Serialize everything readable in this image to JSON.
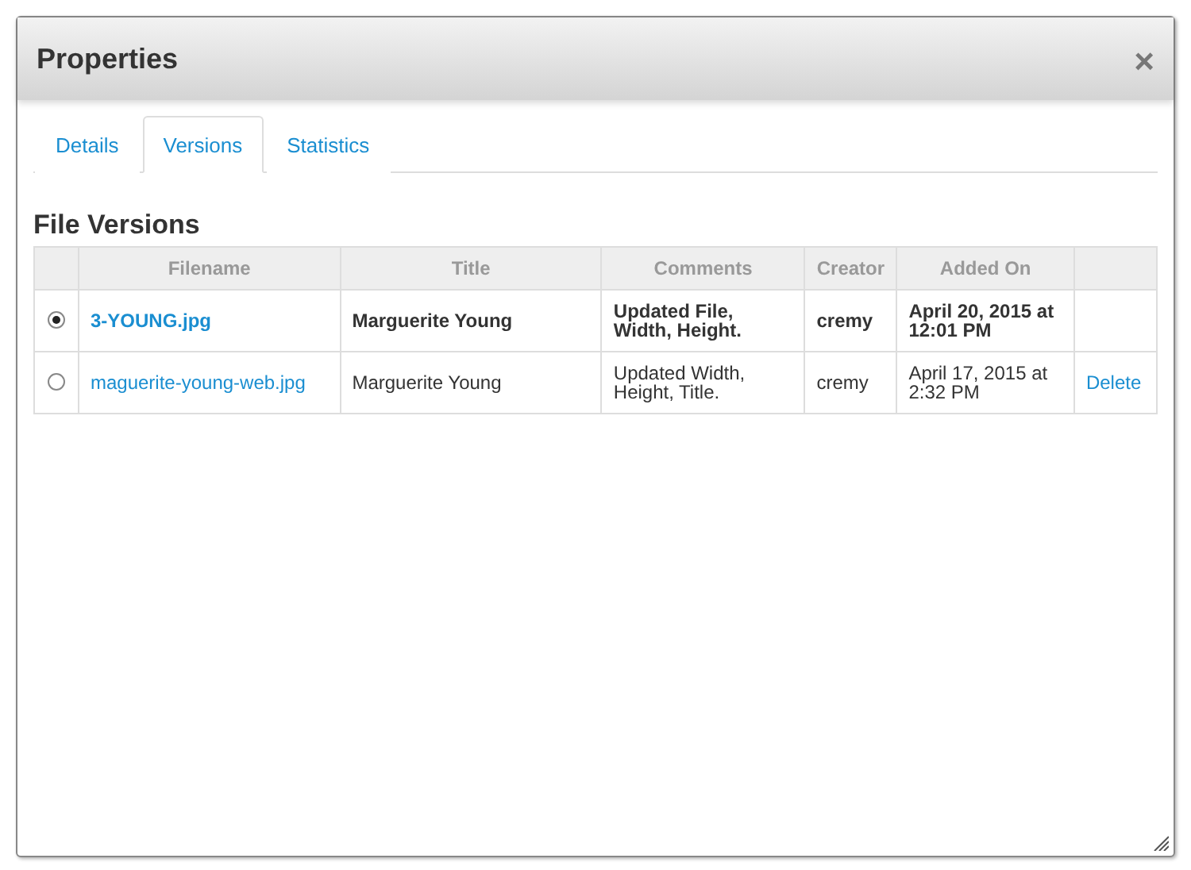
{
  "dialog": {
    "title": "Properties",
    "close": "×"
  },
  "tabs": [
    {
      "label": "Details",
      "selected": false
    },
    {
      "label": "Versions",
      "selected": true
    },
    {
      "label": "Statistics",
      "selected": false
    }
  ],
  "section_title": "File Versions",
  "table": {
    "columns": [
      "Filename",
      "Title",
      "Comments",
      "Creator",
      "Added On"
    ],
    "rows": [
      {
        "selected": true,
        "filename": "3-YOUNG.jpg",
        "title": "Marguerite Young",
        "comments": "Updated File, Width, Height.",
        "creator": "cremy",
        "added_on": "April 20, 2015 at 12:01 PM"
      },
      {
        "selected": false,
        "filename": "maguerite-young-web.jpg",
        "title": "Marguerite Young",
        "comments": "Updated Width, Height, Title.",
        "creator": "cremy",
        "added_on": "April 17, 2015 at 2:32 PM",
        "action": "Delete"
      }
    ]
  }
}
